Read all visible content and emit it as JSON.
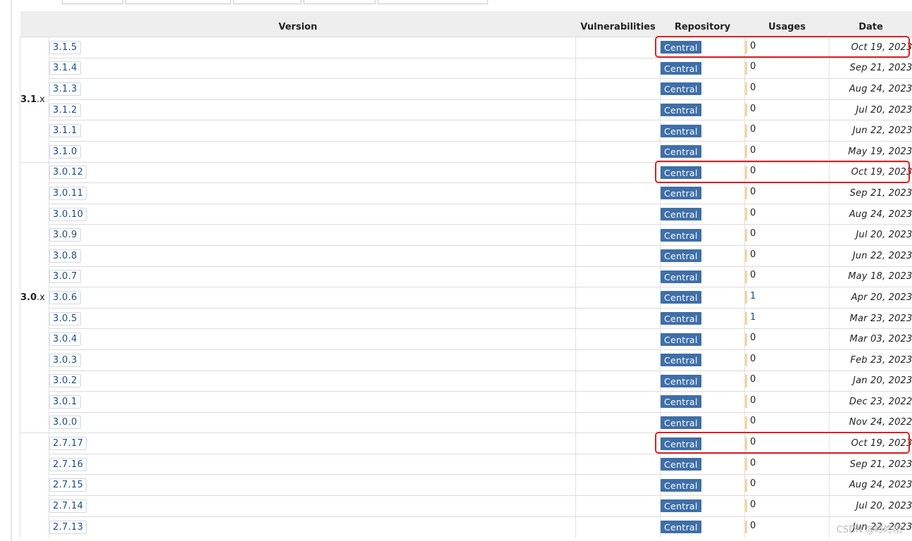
{
  "headers": {
    "version": "Version",
    "vulnerabilities": "Vulnerabilities",
    "repository": "Repository",
    "usages": "Usages",
    "date": "Date"
  },
  "groups": [
    {
      "label_bold": "3.1",
      "label_suffix": ".x",
      "rows": [
        {
          "version": "3.1.5",
          "repo": "Central",
          "usages": "0",
          "date": "Oct 19, 2023",
          "highlight": true
        },
        {
          "version": "3.1.4",
          "repo": "Central",
          "usages": "0",
          "date": "Sep 21, 2023"
        },
        {
          "version": "3.1.3",
          "repo": "Central",
          "usages": "0",
          "date": "Aug 24, 2023"
        },
        {
          "version": "3.1.2",
          "repo": "Central",
          "usages": "0",
          "date": "Jul 20, 2023"
        },
        {
          "version": "3.1.1",
          "repo": "Central",
          "usages": "0",
          "date": "Jun 22, 2023"
        },
        {
          "version": "3.1.0",
          "repo": "Central",
          "usages": "0",
          "date": "May 19, 2023"
        }
      ]
    },
    {
      "label_bold": "3.0",
      "label_suffix": ".x",
      "rows": [
        {
          "version": "3.0.12",
          "repo": "Central",
          "usages": "0",
          "date": "Oct 19, 2023",
          "highlight": true
        },
        {
          "version": "3.0.11",
          "repo": "Central",
          "usages": "0",
          "date": "Sep 21, 2023"
        },
        {
          "version": "3.0.10",
          "repo": "Central",
          "usages": "0",
          "date": "Aug 24, 2023"
        },
        {
          "version": "3.0.9",
          "repo": "Central",
          "usages": "0",
          "date": "Jul 20, 2023"
        },
        {
          "version": "3.0.8",
          "repo": "Central",
          "usages": "0",
          "date": "Jun 22, 2023"
        },
        {
          "version": "3.0.7",
          "repo": "Central",
          "usages": "0",
          "date": "May 18, 2023"
        },
        {
          "version": "3.0.6",
          "repo": "Central",
          "usages": "1",
          "date": "Apr 20, 2023"
        },
        {
          "version": "3.0.5",
          "repo": "Central",
          "usages": "1",
          "date": "Mar 23, 2023"
        },
        {
          "version": "3.0.4",
          "repo": "Central",
          "usages": "0",
          "date": "Mar 03, 2023"
        },
        {
          "version": "3.0.3",
          "repo": "Central",
          "usages": "0",
          "date": "Feb 23, 2023"
        },
        {
          "version": "3.0.2",
          "repo": "Central",
          "usages": "0",
          "date": "Jan 20, 2023"
        },
        {
          "version": "3.0.1",
          "repo": "Central",
          "usages": "0",
          "date": "Dec 23, 2022"
        },
        {
          "version": "3.0.0",
          "repo": "Central",
          "usages": "0",
          "date": "Nov 24, 2022"
        }
      ]
    },
    {
      "label_bold": "",
      "label_suffix": "",
      "rows": [
        {
          "version": "2.7.17",
          "repo": "Central",
          "usages": "0",
          "date": "Oct 19, 2023",
          "highlight": true
        },
        {
          "version": "2.7.16",
          "repo": "Central",
          "usages": "0",
          "date": "Sep 21, 2023"
        },
        {
          "version": "2.7.15",
          "repo": "Central",
          "usages": "0",
          "date": "Aug 24, 2023"
        },
        {
          "version": "2.7.14",
          "repo": "Central",
          "usages": "0",
          "date": "Jul 20, 2023"
        },
        {
          "version": "2.7.13",
          "repo": "Central",
          "usages": "0",
          "date": "Jun 22, 2023"
        }
      ]
    }
  ],
  "watermark": "CSDN @咚咚阳",
  "colors": {
    "central_badge": "#3f6fa8",
    "version_link": "#1a4c8a",
    "usage_bar": "#f5d59b",
    "highlight_box": "#e02020",
    "header_bg": "#eeeeee"
  }
}
